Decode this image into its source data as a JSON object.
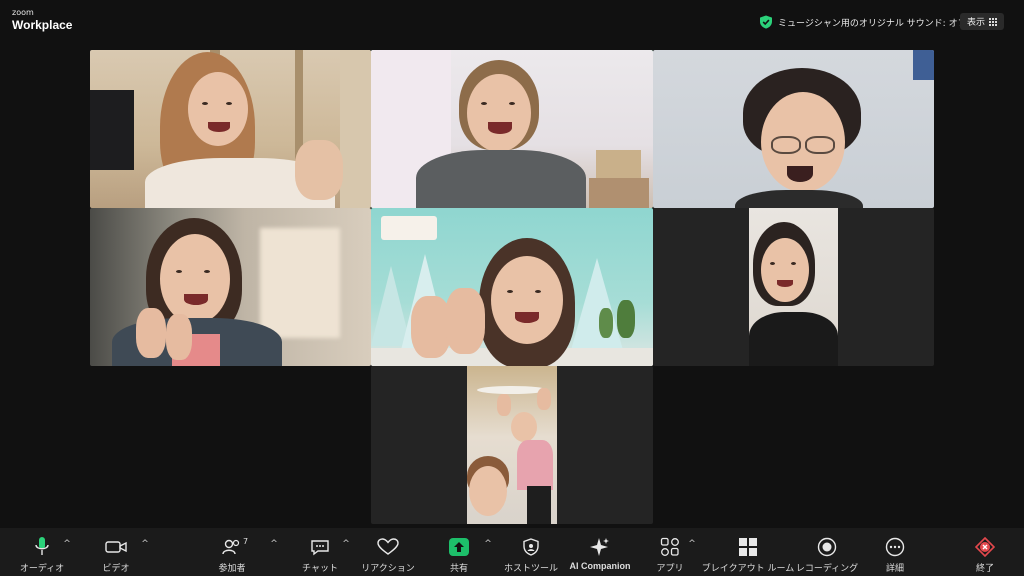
{
  "app": {
    "brand_small": "zoom",
    "brand_big": "Workplace"
  },
  "header": {
    "audio_status": "ミュージシャン用のオリジナル サウンド: オフ",
    "view_button": "表示"
  },
  "colors": {
    "accent_green": "#2bd27a",
    "end_red": "#e5484d",
    "share_green": "#1dbf6a"
  },
  "toolbar": {
    "audio": "オーディオ",
    "video": "ビデオ",
    "participants": "参加者",
    "participants_count": "7",
    "chat": "チャット",
    "reactions": "リアクション",
    "share": "共有",
    "host_tools": "ホストツール",
    "ai_companion": "AI Companion",
    "apps": "アプリ",
    "breakout": "ブレイクアウト ルーム",
    "record": "レコーディング",
    "more": "詳細",
    "end": "終了"
  },
  "icons": {
    "audio": "microphone-icon",
    "video": "camera-icon",
    "participants": "people-icon",
    "chat": "chat-bubble-icon",
    "reactions": "heart-icon",
    "share": "share-arrow-icon",
    "host_tools": "shield-icon",
    "ai_companion": "sparkle-icon",
    "apps": "apps-icon",
    "breakout": "grid-icon",
    "record": "record-icon",
    "more": "more-dots-icon",
    "end": "end-icon"
  }
}
